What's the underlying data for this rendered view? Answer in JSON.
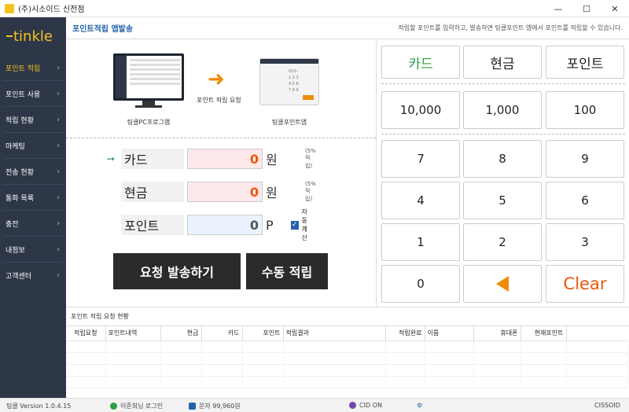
{
  "window": {
    "title": "(주)시소이드 신전점",
    "min": "—",
    "max": "☐",
    "close": "✕"
  },
  "sidebar": {
    "logo": "tinkle",
    "items": [
      {
        "label": "포인트 적립",
        "active": true
      },
      {
        "label": "포인트 사용"
      },
      {
        "label": "적립 현황"
      },
      {
        "label": "마케팅"
      },
      {
        "label": "전송 현황"
      },
      {
        "label": "통화 목록"
      },
      {
        "label": "충전"
      },
      {
        "label": "내정보"
      },
      {
        "label": "고객센터"
      }
    ]
  },
  "header": {
    "title": "포인트적립 앱발송",
    "description": "적립할 포인트를 입력하고, 발송하면 팅클포인트 앱에서 포인트를 적립할 수 있습니다."
  },
  "illustration": {
    "pc_label": "팅클PC프로그램",
    "arrow_label": "포인트 적립 요청",
    "app_label": "팅클포인트앱"
  },
  "form": {
    "card": {
      "label": "카드",
      "value": "0",
      "unit": "원",
      "note": "(5%적립)"
    },
    "cash": {
      "label": "현금",
      "value": "0",
      "unit": "원",
      "note": "(5%적립)"
    },
    "point": {
      "label": "포인트",
      "value": "0",
      "unit": "P"
    },
    "auto_calc": {
      "label": "자동 계산",
      "checked": true
    },
    "send_button": "요청 발송하기",
    "manual_button": "수동 적립"
  },
  "keypad": {
    "modes": [
      "카드",
      "현금",
      "포인트"
    ],
    "amounts": [
      "10,000",
      "1,000",
      "100"
    ],
    "digits": [
      "7",
      "8",
      "9",
      "4",
      "5",
      "6",
      "1",
      "2",
      "3",
      "0"
    ],
    "clear": "Clear",
    "colors": {
      "active_mode": "#2f9e44",
      "accent": "#f08a00",
      "clear": "#e8590c"
    }
  },
  "history": {
    "title": "포인트 적립 요청 현황",
    "columns": [
      "적립요청",
      "포인트내역",
      "현금",
      "카드",
      "포인트",
      "적립결과",
      "적립완료",
      "이름",
      "휴대폰",
      "현재포인트"
    ]
  },
  "status": {
    "version": "팅클 Version 1.0.4.15",
    "user": "이준희님 로그인",
    "sms": "문자 99,960원",
    "cid": "CID ON",
    "brand": "CISSOID"
  }
}
